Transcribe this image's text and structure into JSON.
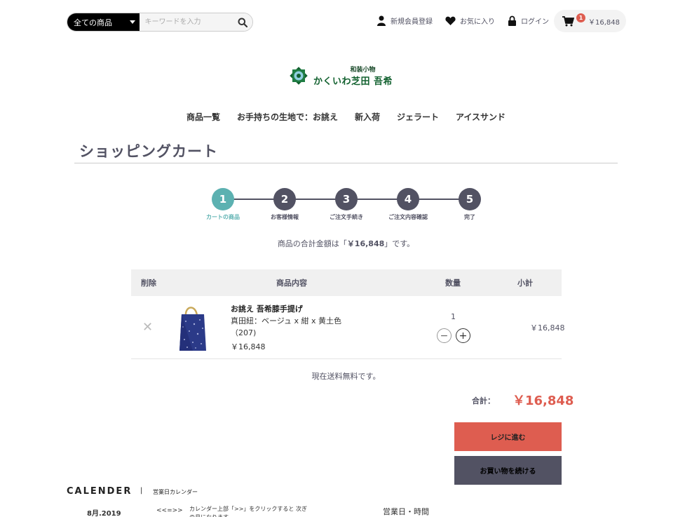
{
  "search": {
    "category": "全ての商品",
    "placeholder": "キーワードを入力"
  },
  "header_nav": {
    "register": "新規会員登録",
    "favorites": "お気に入り",
    "login": "ログイン"
  },
  "cart": {
    "count": "1",
    "total": "￥16,848"
  },
  "logo": {
    "sub": "和装小物",
    "main": "かくいわ芝田 吾希"
  },
  "global_nav": [
    "商品一覧",
    "お手持ちの生地で：お誂え",
    "新入荷",
    "ジェラート",
    "アイスサンド"
  ],
  "page_title": "ショッピングカート",
  "steps": [
    {
      "num": "1",
      "label": "カートの商品"
    },
    {
      "num": "2",
      "label": "お客様情報"
    },
    {
      "num": "3",
      "label": "ご注文手続き"
    },
    {
      "num": "4",
      "label": "ご注文内容確認"
    },
    {
      "num": "5",
      "label": "完了"
    }
  ],
  "total_message": {
    "prefix": "商品の合計金額は「",
    "amount": "￥16,848",
    "suffix": "」です。"
  },
  "table": {
    "headers": [
      "削除",
      "商品内容",
      "数量",
      "小計"
    ],
    "item": {
      "name": "お誂え 吾希膝手提げ",
      "variant": "真田紐：ベージュ x 紺 x 黄土色（207)",
      "price": "￥16,848",
      "quantity": "1",
      "subtotal": "￥16,848"
    }
  },
  "shipping": "現在送料無料です。",
  "summary": {
    "label": "合計：",
    "value": "￥16,848"
  },
  "buttons": {
    "checkout": "レジに進む",
    "continue": "お買い物を続ける"
  },
  "calendar": {
    "heading": "CALENDER",
    "separator": "|",
    "subheading": "営業日カレンダー",
    "month": "8月.2019",
    "nav": "<<=>>",
    "note": "カレンダー上部「>>」をクリックすると 次ぎの月になります",
    "hours": "営業日・時間"
  },
  "colors": {
    "accent": "#5cb1b1",
    "primary": "#525263",
    "danger": "#de5d50"
  }
}
